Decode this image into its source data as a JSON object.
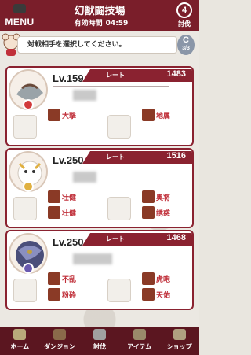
{
  "header": {
    "menu_label": "MENU",
    "title": "幻獣闘技場",
    "timer_label": "有効時間",
    "timer_value": "04:59",
    "hunt_count": "4",
    "hunt_label": "討伐"
  },
  "prompt": {
    "text": "対戦相手を選択してください。",
    "reload_letter": "C",
    "reload_count": "3/3"
  },
  "opponents": [
    {
      "level": "Lv.159",
      "rate_label": "レート",
      "rate_value": "1483",
      "skills": [
        "大撃",
        "地属"
      ]
    },
    {
      "level": "Lv.250",
      "rate_label": "レート",
      "rate_value": "1516",
      "skills": [
        "壮健",
        "奥将",
        "壮健",
        "誘惑"
      ]
    },
    {
      "level": "Lv.250",
      "rate_label": "レート",
      "rate_value": "1468",
      "skills": [
        "不乱",
        "虎咆",
        "粉砕",
        "天佑"
      ]
    }
  ],
  "nav": [
    "ホーム",
    "ダンジョン",
    "討伐",
    "アイテム",
    "ショップ"
  ],
  "colors": {
    "brand": "#7a1e2a",
    "nav": "#5b1620",
    "skill_text": "#c0303a"
  }
}
